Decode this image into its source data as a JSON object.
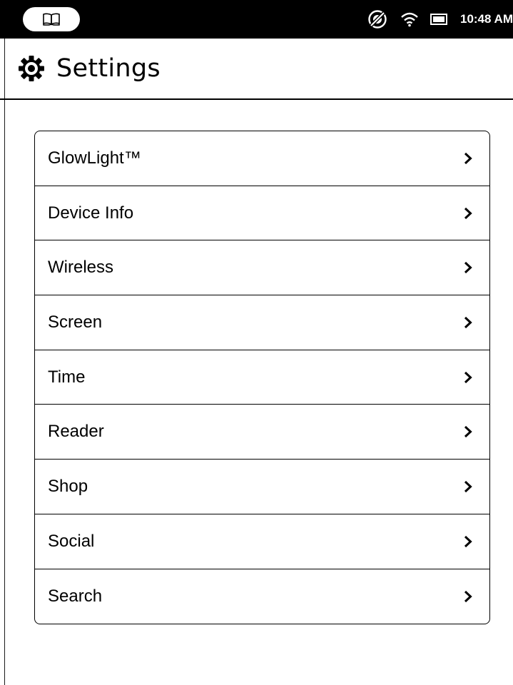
{
  "status_bar": {
    "time": "10:48 AM",
    "icons": {
      "library": "open-book-icon",
      "sync": "sync-off-icon",
      "wifi": "wifi-icon",
      "battery": "battery-icon"
    }
  },
  "header": {
    "icon": "gear-icon",
    "title": "Settings"
  },
  "settings": {
    "items": [
      {
        "label": "GlowLight™"
      },
      {
        "label": "Device Info"
      },
      {
        "label": "Wireless"
      },
      {
        "label": "Screen"
      },
      {
        "label": "Time"
      },
      {
        "label": "Reader"
      },
      {
        "label": "Shop"
      },
      {
        "label": "Social"
      },
      {
        "label": "Search"
      }
    ]
  },
  "colors": {
    "status_bar_bg": "#000000",
    "page_bg": "#ffffff",
    "text": "#000000"
  }
}
